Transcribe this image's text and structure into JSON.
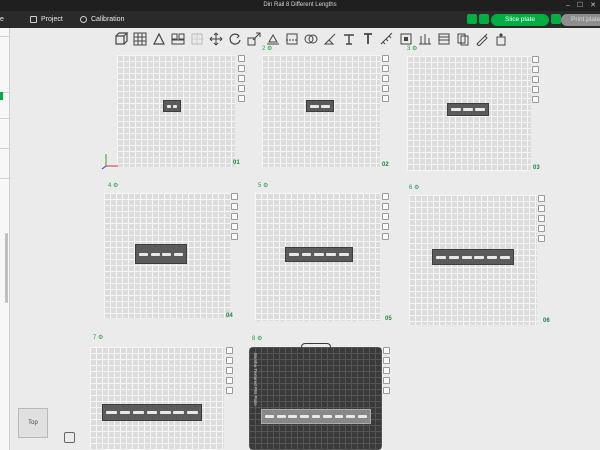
{
  "window": {
    "title": "Din Rail 8 Different Lengths",
    "controls": [
      "–",
      "☐",
      "✕"
    ]
  },
  "menu": {
    "first_tab_fragment": "e",
    "tabs": [
      "Project",
      "Calibration"
    ],
    "slice_button": "Slice plate",
    "print_button": "Print plate"
  },
  "toolbar": {
    "icons": [
      "add-cube-icon",
      "grid-icon",
      "orient-icon",
      "arrange-icon",
      "split-icon",
      "move-icon",
      "rotate-icon",
      "scale-icon",
      "lay-flat-icon",
      "cut-icon",
      "boolean-icon",
      "paint-icon",
      "seam-icon",
      "text-icon",
      "measure-icon",
      "assembly-icon",
      "support-icon",
      "variable-layer-icon",
      "height-range-icon",
      "brush-icon",
      "view-icon"
    ]
  },
  "plates": [
    {
      "num": "01",
      "tag": "",
      "rail_segments": 2,
      "selected": false
    },
    {
      "num": "02",
      "tag": "2 ⚙",
      "rail_segments": 2,
      "selected": false
    },
    {
      "num": "03",
      "tag": "3 ⚙",
      "rail_segments": 3,
      "selected": false
    },
    {
      "num": "04",
      "tag": "4 ⚙",
      "rail_segments": 4,
      "selected": false
    },
    {
      "num": "05",
      "tag": "5 ⚙",
      "rail_segments": 5,
      "selected": false
    },
    {
      "num": "06",
      "tag": "6 ⚙",
      "rail_segments": 6,
      "selected": false
    },
    {
      "num": "",
      "tag": "7 ⚙",
      "rail_segments": 7,
      "selected": false
    },
    {
      "num": "",
      "tag": "8 ⚙",
      "rail_segments": 9,
      "selected": true,
      "label": "Bambu Textured PEI Plate"
    }
  ],
  "viewcube": {
    "label": "Top"
  },
  "colors": {
    "accent": "#00ae42",
    "titlebar": "#1f1f1f",
    "menubar": "#2a2a2a",
    "plate": "#dcdcdc",
    "plate_dark": "#3a3a3a",
    "rail": "#5b5b5b"
  }
}
